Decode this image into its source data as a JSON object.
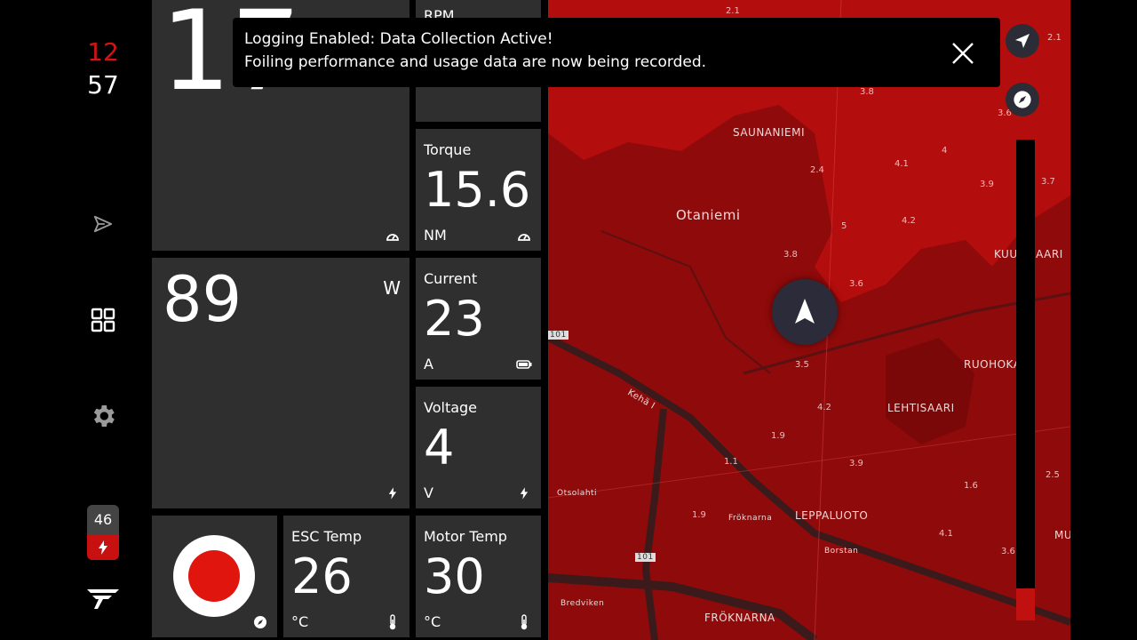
{
  "clock": {
    "hours": "12",
    "minutes": "57"
  },
  "battery": {
    "level": "46"
  },
  "speed": {
    "value": "17"
  },
  "rpm": {
    "label": "RPM"
  },
  "torque": {
    "label": "Torque",
    "value": "15.6",
    "unit": "NM"
  },
  "power": {
    "value": "89",
    "unit": "W"
  },
  "current": {
    "label": "Current",
    "value": "23",
    "unit": "A"
  },
  "voltage": {
    "label": "Voltage",
    "value": "4",
    "unit": "V"
  },
  "esc_temp": {
    "label": "ESC Temp",
    "value": "26",
    "unit": "°C"
  },
  "motor_temp": {
    "label": "Motor Temp",
    "value": "30",
    "unit": "°C"
  },
  "toast": {
    "title": "Logging Enabled: Data Collection Active!",
    "message": "Foiling performance and usage data are now being recorded."
  },
  "map": {
    "places": [
      "SAUNANIEMI",
      "Otaniemi",
      "KUUSISAARI",
      "RUOHOKARI",
      "LEHTISAARI",
      "LEPPALUOTO",
      "FRÖKNARNA",
      "MUS",
      "Otsolahti",
      "Fröknarna",
      "Borstan",
      "Bredviken",
      "Kehä I",
      "101",
      "101"
    ],
    "depths": [
      "2.1",
      "2.1",
      "3.8",
      "3.6",
      "4.1",
      "4",
      "3.9",
      "3.7",
      "2.4",
      "4.2",
      "5",
      "3.8",
      "3.6",
      "3.5",
      "4.2",
      "1.9",
      "3.9",
      "1.1",
      "1.6",
      "2.5",
      "1.9",
      "4.1",
      "3.6"
    ]
  },
  "colors": {
    "accent": "#d11414",
    "tile": "#2f2f2f",
    "map": "#b30d0d"
  }
}
